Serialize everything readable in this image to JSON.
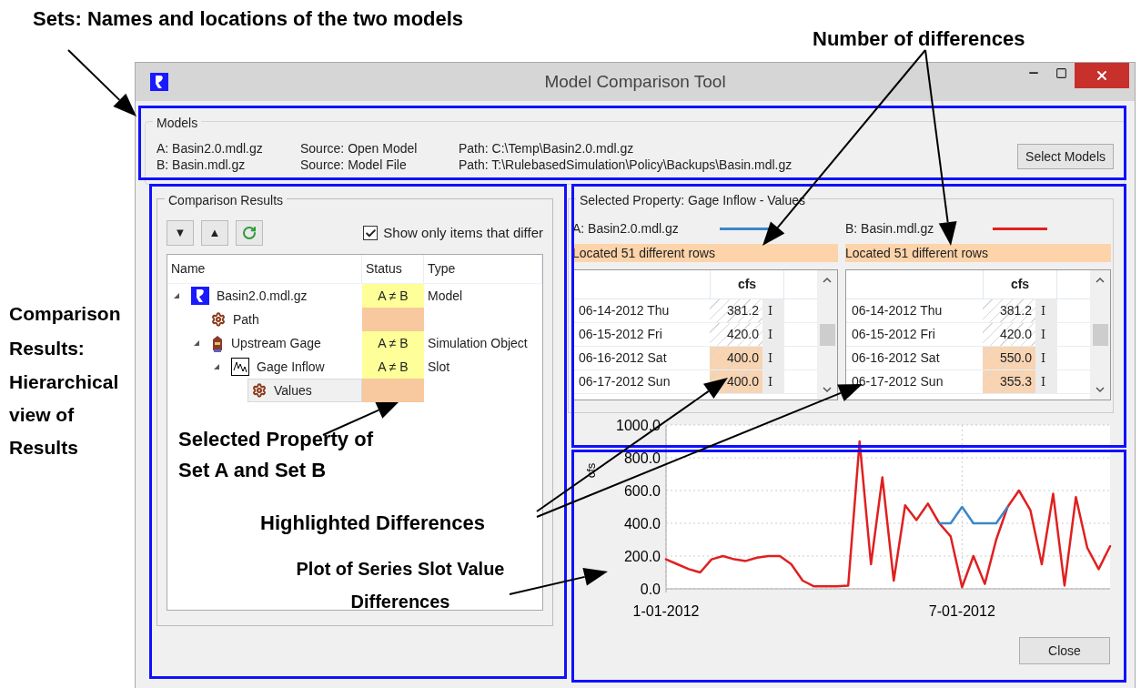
{
  "annotations": [
    {
      "text": "Sets: Names and locations of the two models"
    },
    {
      "text": "Number of differences"
    },
    {
      "text": "Comparison Results:"
    },
    {
      "text": "Hierarchical view of Results"
    },
    {
      "text": "Selected Property of Set A and Set B"
    },
    {
      "text": "Highlighted Differences"
    },
    {
      "text": "Plot of Series Slot Value Differences"
    }
  ],
  "window": {
    "title": "Model Comparison Tool"
  },
  "models": {
    "title": "Models",
    "rows": [
      {
        "name": "A: Basin2.0.mdl.gz",
        "source": "Source: Open Model",
        "path": "Path: C:\\Temp\\Basin2.0.mdl.gz"
      },
      {
        "name": "B: Basin.mdl.gz",
        "source": "Source: Model File",
        "path": "Path: T:\\RulebasedSimulation\\Policy\\Backups\\Basin.mdl.gz"
      }
    ],
    "button": "Select Models"
  },
  "comparison": {
    "title": "Comparison Results",
    "buttons": [
      {
        "kind": "down",
        "label": "▼"
      },
      {
        "kind": "up",
        "label": "▲"
      },
      {
        "kind": "refresh"
      }
    ],
    "filter": {
      "label": "Show only items that differ",
      "checked": true
    },
    "columns": [
      "Name",
      "Status",
      "Type"
    ],
    "rows": [
      {
        "name": "Basin2.0.mdl.gz",
        "kind": "model",
        "status": "A ≠ B",
        "color": "#ffff99",
        "type": "Model",
        "expanded": true,
        "selected": false,
        "children": [
          {
            "name": "Path",
            "kind": "gear",
            "color": "#f8c89e",
            "selected": false
          },
          {
            "name": "Upstream Gage",
            "kind": "gage",
            "status": "A ≠ B",
            "color": "#ffff99",
            "type": "Simulation Object",
            "expanded": true,
            "selected": false,
            "children": [
              {
                "name": "Gage Inflow",
                "kind": "series",
                "status": "A ≠ B",
                "color": "#ffff99",
                "type": "Slot",
                "expanded": true,
                "selected": false,
                "children": [
                  {
                    "name": "Values",
                    "kind": "gear",
                    "color": "#f8c89e",
                    "selected": true
                  }
                ]
              }
            ]
          }
        ]
      }
    ]
  },
  "property": {
    "title": "Selected Property: Gage Inflow - Values",
    "sides": [
      {
        "label": "A: Basin2.0.mdl.gz",
        "color": "#3c87c8",
        "message": "Located 51 different rows",
        "unit": "cfs",
        "rows": [
          {
            "date": "06-14-2012 Thu",
            "value": "381.2",
            "flag": "I",
            "differs": false
          },
          {
            "date": "06-15-2012 Fri",
            "value": "420.0",
            "flag": "I",
            "differs": false
          },
          {
            "date": "06-16-2012 Sat",
            "value": "400.0",
            "flag": "I",
            "differs": true
          },
          {
            "date": "06-17-2012 Sun",
            "value": "400.0",
            "flag": "I",
            "differs": true
          }
        ]
      },
      {
        "label": "B: Basin.mdl.gz",
        "color": "#e02020",
        "message": "Located 51 different rows",
        "unit": "cfs",
        "rows": [
          {
            "date": "06-14-2012 Thu",
            "value": "381.2",
            "flag": "I",
            "differs": false
          },
          {
            "date": "06-15-2012 Fri",
            "value": "420.0",
            "flag": "I",
            "differs": false
          },
          {
            "date": "06-16-2012 Sat",
            "value": "550.0",
            "flag": "I",
            "differs": true
          },
          {
            "date": "06-17-2012 Sun",
            "value": "355.3",
            "flag": "I",
            "differs": true
          }
        ]
      }
    ],
    "chart_data": {
      "type": "line",
      "ylabel": "cfs",
      "categories": [
        "1-01-2012",
        null,
        null,
        null,
        null,
        null,
        null,
        null,
        null,
        null,
        null,
        null,
        null,
        null,
        null,
        null,
        null,
        null,
        null,
        null,
        null,
        null,
        null,
        null,
        null,
        null,
        "7-01-2012",
        null,
        null,
        null,
        null,
        null,
        null,
        null,
        null,
        null,
        null,
        null,
        null,
        null
      ],
      "series": [
        {
          "color": "#3c87c8",
          "values": [
            null,
            null,
            null,
            null,
            null,
            null,
            null,
            null,
            null,
            null,
            null,
            null,
            null,
            null,
            null,
            null,
            null,
            null,
            null,
            null,
            null,
            null,
            null,
            null,
            400,
            400,
            500,
            400,
            400,
            400,
            500,
            null,
            null,
            null,
            null,
            null,
            null,
            null,
            null,
            null
          ]
        },
        {
          "color": "#e02020",
          "values": [
            180,
            150,
            120,
            100,
            180,
            200,
            180,
            170,
            190,
            200,
            200,
            150,
            50,
            15,
            15,
            15,
            20,
            900,
            150,
            680,
            50,
            510,
            420,
            520,
            400,
            320,
            10,
            200,
            30,
            300,
            500,
            600,
            480,
            150,
            580,
            20,
            560,
            250,
            120,
            260
          ]
        }
      ],
      "ylim": [
        0,
        1000
      ],
      "grid": true,
      "yticks": [
        {
          "value": 0,
          "label": "0.0"
        },
        {
          "value": 200,
          "label": "200.0"
        },
        {
          "value": 400,
          "label": "400.0"
        },
        {
          "value": 600,
          "label": "600.0"
        },
        {
          "value": 800,
          "label": "800.0"
        },
        {
          "value": 1000,
          "label": "1000.0"
        }
      ]
    }
  },
  "close_button": "Close"
}
